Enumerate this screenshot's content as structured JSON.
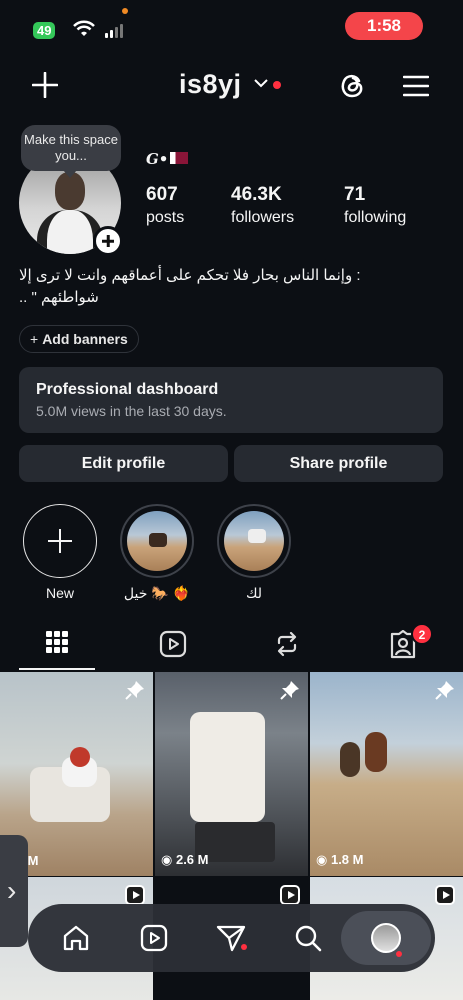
{
  "status_bar": {
    "battery": "49",
    "time": "1:58"
  },
  "header": {
    "username": "is8yj"
  },
  "profile": {
    "bubble_text": "Make this space you...",
    "name": "G•",
    "stats": [
      {
        "num": "607",
        "label": "posts"
      },
      {
        "num": "46.3K",
        "label": "followers"
      },
      {
        "num": "71",
        "label": "following"
      }
    ],
    "bio": ": وإنما الناس بحار فلا تحكم على أعماقهم وانت لا ترى إلا شواطئهم \" ..",
    "add_banners": "Add banners",
    "dashboard_title": "Professional dashboard",
    "dashboard_sub": "5.0M views in the last 30 days.",
    "edit_profile": "Edit profile",
    "share_profile": "Share profile"
  },
  "highlights": [
    {
      "label": "New"
    },
    {
      "label": "خيل 🐎 ❤️‍🔥"
    },
    {
      "label": "لك"
    }
  ],
  "tabs": {
    "tagged_badge": "2"
  },
  "grid": [
    {
      "views": "2.3 M"
    },
    {
      "views": "2.6 M"
    },
    {
      "views": "1.8 M"
    }
  ],
  "colors": {
    "accent_red": "#ff3040",
    "background": "#0c0f14",
    "button_bg": "#262a31"
  }
}
